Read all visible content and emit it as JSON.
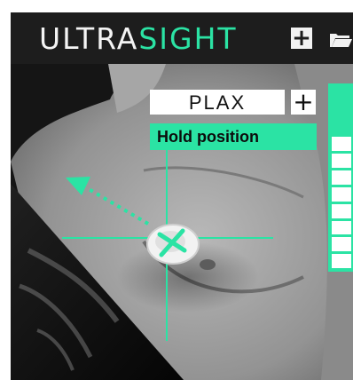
{
  "header": {
    "logo_part1": "ULTRA",
    "logo_part2": "SIGHT",
    "add_icon": "plus-icon",
    "folder_icon": "folder-open-icon"
  },
  "overlay": {
    "view_label": "PLAX",
    "add_view_icon": "plus-icon",
    "hold_message": "Hold position",
    "probe_icon": "probe-icon",
    "guidance_arrow_icon": "dotted-arrow-icon"
  },
  "progress": {
    "segments_total": 11,
    "segments_filled": 3
  },
  "colors": {
    "accent": "#2be3a4",
    "header_bg": "#1d1d1d",
    "label_bg": "#ffffff"
  }
}
